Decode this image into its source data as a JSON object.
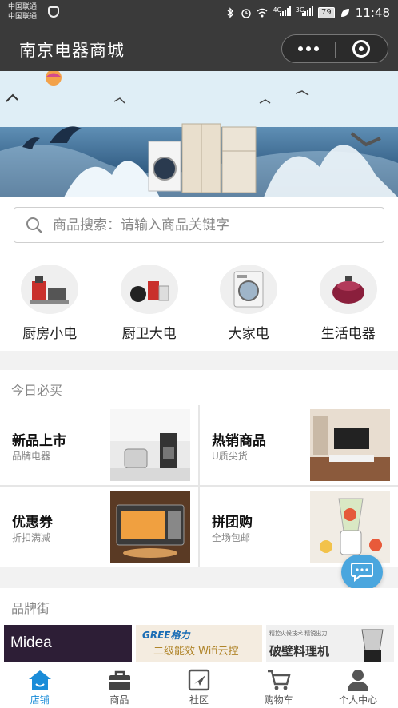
{
  "status_bar": {
    "carrier_1": "中国联通",
    "carrier_2": "中国联通",
    "network_1": "4G",
    "network_2": "3G",
    "battery": "79",
    "time": "11:48"
  },
  "nav": {
    "title": "南京电器商城"
  },
  "search": {
    "placeholder": "商品搜索：请输入商品关键字"
  },
  "categories": [
    {
      "label": "厨房小电",
      "icon": "kitchen-appliance-icon"
    },
    {
      "label": "厨卫大电",
      "icon": "kitchen-bath-appliance-icon"
    },
    {
      "label": "大家电",
      "icon": "washing-machine-icon"
    },
    {
      "label": "生活电器",
      "icon": "home-appliance-icon"
    }
  ],
  "today": {
    "heading": "今日必买",
    "tiles": [
      {
        "title": "新品上市",
        "subtitle": "品牌电器"
      },
      {
        "title": "热销商品",
        "subtitle": "U质尖货"
      },
      {
        "title": "优惠券",
        "subtitle": "折扣满减"
      },
      {
        "title": "拼团购",
        "subtitle": "全场包邮"
      }
    ]
  },
  "brands": {
    "heading": "品牌街",
    "items": [
      {
        "logo_text": "Midea"
      },
      {
        "logo_text": "GREE格力",
        "tagline": "二级能效 Wifi云控"
      },
      {
        "tagline_small": "精控火候技术 精锐出刀",
        "tagline": "破壁料理机"
      }
    ]
  },
  "tabbar": {
    "active_color": "#1a8cd8",
    "tabs": [
      {
        "label": "店铺",
        "icon": "store-icon"
      },
      {
        "label": "商品",
        "icon": "bag-icon"
      },
      {
        "label": "社区",
        "icon": "community-icon"
      },
      {
        "label": "购物车",
        "icon": "cart-icon"
      },
      {
        "label": "个人中心",
        "icon": "user-icon"
      }
    ]
  }
}
